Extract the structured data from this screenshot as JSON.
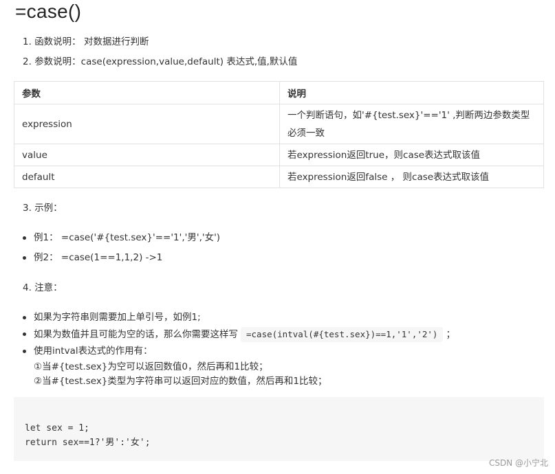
{
  "title": "=case()",
  "list1": {
    "items": [
      {
        "num": "1.",
        "text": "函数说明： 对数据进行判断"
      },
      {
        "num": "2.",
        "text": "参数说明：case(expression,value,default) 表达式,值,默认值"
      }
    ]
  },
  "table": {
    "headers": [
      "参数",
      "说明"
    ],
    "rows": [
      {
        "param": "expression",
        "desc_line1": "一个判断语句，如'#{test.sex}'=='1' ,判断两边参数类型",
        "desc_line2": "必须一致"
      },
      {
        "param": "value",
        "desc": "若expression返回true，则case表达式取该值"
      },
      {
        "param": "default",
        "desc": "若expression返回false ， 则case表达式取该值"
      }
    ]
  },
  "section3": {
    "num": "3.",
    "text": "示例："
  },
  "examples": [
    {
      "label": "例1：",
      "text": "=case('#{test.sex}'=='1','男','女')"
    },
    {
      "label": "例2：",
      "text": "=case(1==1,1,2) ->1"
    }
  ],
  "section4": {
    "num": "4.",
    "text": "注意："
  },
  "notes": {
    "item1": "如果为字符串则需要加上单引号，如例1;",
    "item2_prefix": "如果为数值并且可能为空的话，那么你需要这样写",
    "item2_code": "=case(intval(#{test.sex})==1,'1','2')",
    "item2_suffix": "；",
    "item3": "使用intval表达式的作用有：",
    "item3_sub1": "①当#{test.sex}为空可以返回数值0，然后再和1比较；",
    "item3_sub2": "②当#{test.sex}类型为字符串可以返回对应的数值，然后再和1比较；"
  },
  "code": {
    "line1": "let sex = 1;",
    "line2": "return sex==1?'男':'女';"
  },
  "watermark": "CSDN @小宁北"
}
